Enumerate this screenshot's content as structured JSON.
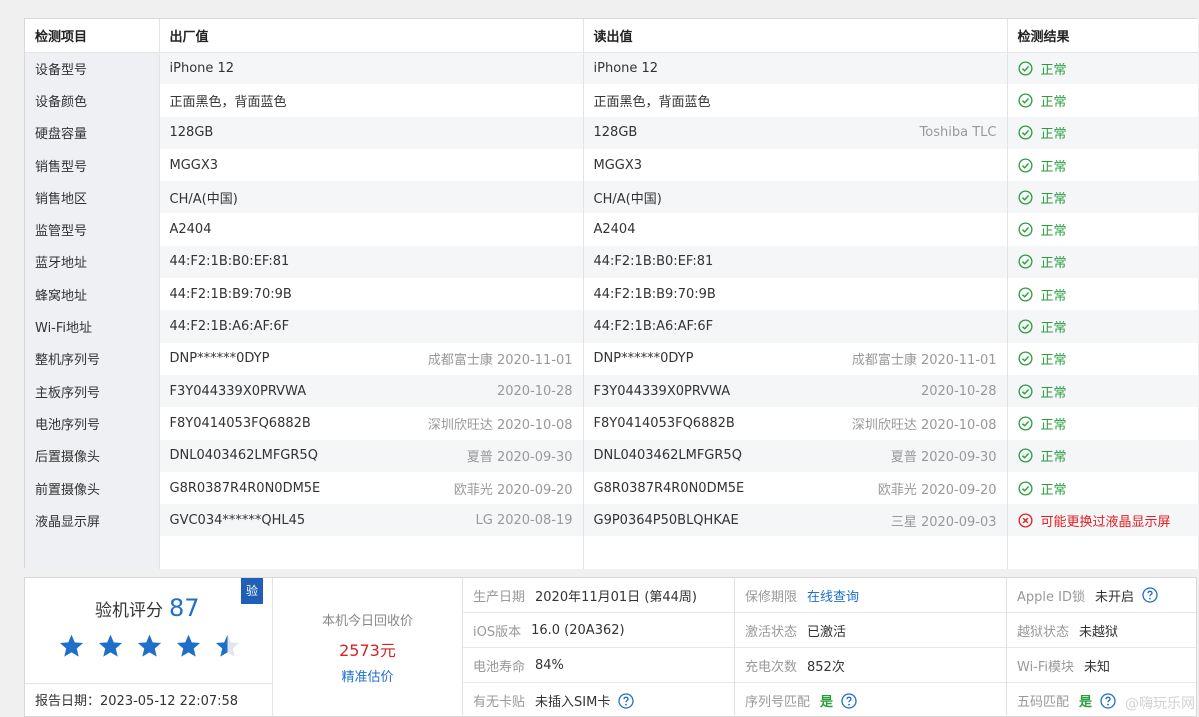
{
  "table": {
    "headers": [
      "检测项目",
      "出厂值",
      "读出值",
      "检测结果"
    ],
    "rows": [
      {
        "label": "设备型号",
        "factory": "iPhone 12",
        "factory_note": "",
        "read": "iPhone 12",
        "read_note": "",
        "result": "正常",
        "ok": true
      },
      {
        "label": "设备颜色",
        "factory": "正面黑色，背面蓝色",
        "factory_note": "",
        "read": "正面黑色，背面蓝色",
        "read_note": "",
        "result": "正常",
        "ok": true
      },
      {
        "label": "硬盘容量",
        "factory": "128GB",
        "factory_note": "",
        "read": "128GB",
        "read_note": "Toshiba TLC",
        "result": "正常",
        "ok": true
      },
      {
        "label": "销售型号",
        "factory": "MGGX3",
        "factory_note": "",
        "read": "MGGX3",
        "read_note": "",
        "result": "正常",
        "ok": true
      },
      {
        "label": "销售地区",
        "factory": "CH/A(中国)",
        "factory_note": "",
        "read": "CH/A(中国)",
        "read_note": "",
        "result": "正常",
        "ok": true
      },
      {
        "label": "监管型号",
        "factory": "A2404",
        "factory_note": "",
        "read": "A2404",
        "read_note": "",
        "result": "正常",
        "ok": true
      },
      {
        "label": "蓝牙地址",
        "factory": "44:F2:1B:B0:EF:81",
        "factory_note": "",
        "read": "44:F2:1B:B0:EF:81",
        "read_note": "",
        "result": "正常",
        "ok": true
      },
      {
        "label": "蜂窝地址",
        "factory": "44:F2:1B:B9:70:9B",
        "factory_note": "",
        "read": "44:F2:1B:B9:70:9B",
        "read_note": "",
        "result": "正常",
        "ok": true
      },
      {
        "label": "Wi-Fi地址",
        "factory": "44:F2:1B:A6:AF:6F",
        "factory_note": "",
        "read": "44:F2:1B:A6:AF:6F",
        "read_note": "",
        "result": "正常",
        "ok": true
      },
      {
        "label": "整机序列号",
        "factory": "DNP******0DYP",
        "factory_note": "成都富士康 2020-11-01",
        "read": "DNP******0DYP",
        "read_note": "成都富士康 2020-11-01",
        "result": "正常",
        "ok": true
      },
      {
        "label": "主板序列号",
        "factory": "F3Y044339X0PRVWA",
        "factory_note": "2020-10-28",
        "read": "F3Y044339X0PRVWA",
        "read_note": "2020-10-28",
        "result": "正常",
        "ok": true
      },
      {
        "label": "电池序列号",
        "factory": "F8Y0414053FQ6882B",
        "factory_note": "深圳欣旺达 2020-10-08",
        "read": "F8Y0414053FQ6882B",
        "read_note": "深圳欣旺达 2020-10-08",
        "result": "正常",
        "ok": true
      },
      {
        "label": "后置摄像头",
        "factory": "DNL0403462LMFGR5Q",
        "factory_note": "夏普 2020-09-30",
        "read": "DNL0403462LMFGR5Q",
        "read_note": "夏普 2020-09-30",
        "result": "正常",
        "ok": true
      },
      {
        "label": "前置摄像头",
        "factory": "G8R0387R4R0N0DM5E",
        "factory_note": "欧菲光 2020-09-20",
        "read": "G8R0387R4R0N0DM5E",
        "read_note": "欧菲光 2020-09-20",
        "result": "正常",
        "ok": true
      },
      {
        "label": "液晶显示屏",
        "factory": "GVC034******QHL45",
        "factory_note": "LG 2020-08-19",
        "read": "G9P0364P50BLQHKAE",
        "read_note": "三星 2020-09-03",
        "result": "可能更换过液晶显示屏",
        "ok": false
      }
    ]
  },
  "score": {
    "label": "验机评分",
    "value": "87",
    "badge": "验",
    "stars": 4.5,
    "report_date": "报告日期：2023-05-12 22:07:58"
  },
  "price": {
    "label": "本机今日回收价",
    "value": "2573元",
    "link": "精准估价"
  },
  "info": {
    "col1": [
      {
        "k": "生产日期",
        "v": "2020年11月01日 (第44周)",
        "style": ""
      },
      {
        "k": "iOS版本",
        "v": "16.0 (20A362)",
        "style": ""
      },
      {
        "k": "电池寿命",
        "v": "84%",
        "style": ""
      },
      {
        "k": "有无卡贴",
        "v": "未插入SIM卡",
        "style": "",
        "help": true
      }
    ],
    "col2": [
      {
        "k": "保修期限",
        "v": "在线查询",
        "style": "link"
      },
      {
        "k": "激活状态",
        "v": "已激活",
        "style": ""
      },
      {
        "k": "充电次数",
        "v": "852次",
        "style": ""
      },
      {
        "k": "序列号匹配",
        "v": "是",
        "style": "green",
        "help": true
      }
    ],
    "col3": [
      {
        "k": "Apple ID锁",
        "v": "未开启",
        "style": "",
        "help": true
      },
      {
        "k": "越狱状态",
        "v": "未越狱",
        "style": ""
      },
      {
        "k": "Wi-Fi模块",
        "v": "未知",
        "style": ""
      },
      {
        "k": "五码匹配",
        "v": "是",
        "style": "green",
        "help": true
      }
    ]
  },
  "watermark": "@嗨玩乐网",
  "colors": {
    "ok": "#2a9d3c",
    "bad": "#e02020",
    "link": "#1f6fc9",
    "star": "#1f6fc9"
  }
}
